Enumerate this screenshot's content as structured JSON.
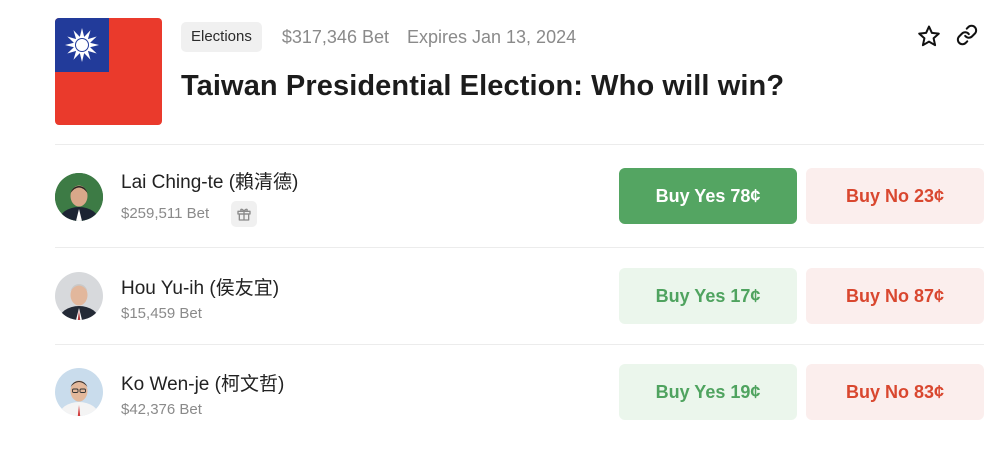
{
  "market": {
    "tag": "Elections",
    "volume": "$317,346 Bet",
    "expires": "Expires Jan 13, 2024",
    "title": "Taiwan Presidential Election: Who will win?"
  },
  "icons": {
    "star": "star-icon",
    "link": "link-icon",
    "gift": "gift-icon",
    "flag": "taiwan-flag"
  },
  "colors": {
    "yes_solid": "#54a562",
    "yes_light_bg": "#ebf6ec",
    "yes_text": "#4fa35f",
    "no_bg": "#fbeeed",
    "no_text": "#d9472f"
  },
  "candidates": [
    {
      "name": "Lai Ching-te (賴清德)",
      "volume": "$259,511 Bet",
      "yes_label": "Buy Yes 78¢",
      "no_label": "Buy No 23¢"
    },
    {
      "name": "Hou Yu-ih (侯友宜)",
      "volume": "$15,459 Bet",
      "yes_label": "Buy Yes 17¢",
      "no_label": "Buy No 87¢"
    },
    {
      "name": "Ko Wen-je (柯文哲)",
      "volume": "$42,376 Bet",
      "yes_label": "Buy Yes 19¢",
      "no_label": "Buy No 83¢"
    }
  ]
}
